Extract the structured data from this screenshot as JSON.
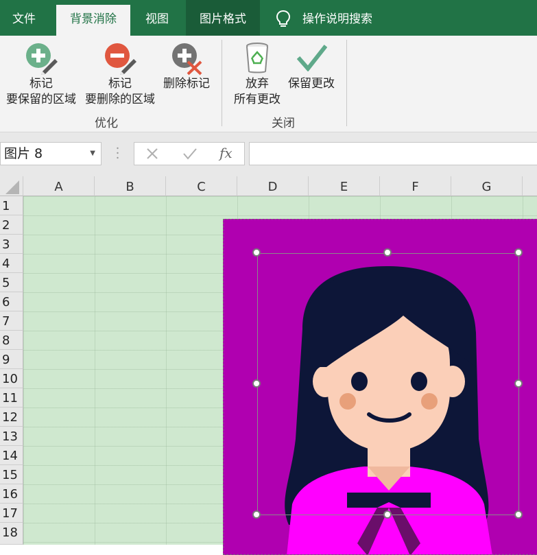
{
  "tabs": {
    "file": "文件",
    "background_removal": "背景消除",
    "view": "视图",
    "picture_format": "图片格式",
    "tell_me": "操作说明搜索"
  },
  "ribbon": {
    "mark_keep": {
      "line1": "标记",
      "line2": "要保留的区域"
    },
    "mark_remove": {
      "line1": "标记",
      "line2": "要删除的区域"
    },
    "delete_mark": "删除标记",
    "discard": {
      "line1": "放弃",
      "line2": "所有更改"
    },
    "keep_changes": "保留更改",
    "group_refine": "优化",
    "group_close": "关闭"
  },
  "formula_bar": {
    "name_box": "图片 8",
    "formula_value": ""
  },
  "grid": {
    "columns": [
      "A",
      "B",
      "C",
      "D",
      "E",
      "F",
      "G"
    ],
    "rows": [
      "1",
      "2",
      "3",
      "4",
      "5",
      "6",
      "7",
      "8",
      "9",
      "10",
      "11",
      "12",
      "13",
      "14",
      "15",
      "16",
      "17",
      "18"
    ]
  },
  "colors": {
    "ribbon_green": "#217346",
    "cell_fill": "#cfe8cf",
    "picture_bg": "#b000b0"
  }
}
